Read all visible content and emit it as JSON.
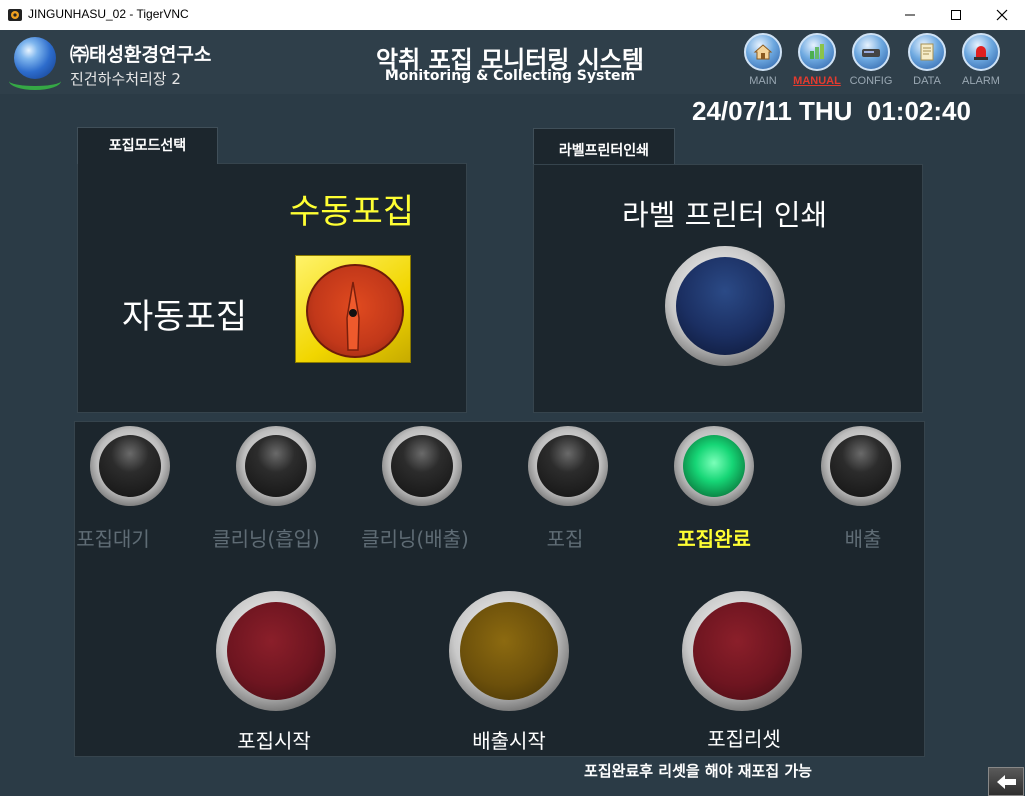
{
  "window": {
    "title": "JINGUNHASU_02 - TigerVNC",
    "minimize_icon": "minimize-icon",
    "maximize_icon": "maximize-icon",
    "close_icon": "close-icon"
  },
  "header": {
    "company": "㈜태성환경연구소",
    "plant": "진건하수처리장 2",
    "title": "악취 포집 모니터링 시스템",
    "subtitle": "Monitoring & Collecting System",
    "datetime": "24/07/11 THU  01:02:40",
    "nav": [
      {
        "label": "MAIN",
        "icon": "house-icon",
        "active": false
      },
      {
        "label": "MANUAL",
        "icon": "manual-icon",
        "active": true
      },
      {
        "label": "CONFIG",
        "icon": "config-icon",
        "active": false
      },
      {
        "label": "DATA",
        "icon": "data-icon",
        "active": false
      },
      {
        "label": "ALARM",
        "icon": "alarm-icon",
        "active": false
      }
    ]
  },
  "mode_panel": {
    "tab": "포집모드선택",
    "manual_label": "수동포집",
    "auto_label": "자동포집",
    "selected": "수동포집"
  },
  "printer_panel": {
    "tab": "라벨프린터인쇄",
    "label": "라벨 프린터 인쇄"
  },
  "status_lamps": [
    {
      "label": "포집대기",
      "on": false
    },
    {
      "label": "클리닝(흡입)",
      "on": false
    },
    {
      "label": "클리닝(배출)",
      "on": false
    },
    {
      "label": "포집",
      "on": false
    },
    {
      "label": "포집완료",
      "on": true
    },
    {
      "label": "배출",
      "on": false
    }
  ],
  "buttons": {
    "start": "포집시작",
    "discharge": "배출시작",
    "reset": "포집리셋"
  },
  "note": "포집완료후 리셋을 해야 재포집 가능",
  "colors": {
    "background": "#2b3b46",
    "panel": "#1c262d",
    "active_text": "#ffff33",
    "lamp_on": "#16d676",
    "nav_active": "#e33b2f"
  }
}
